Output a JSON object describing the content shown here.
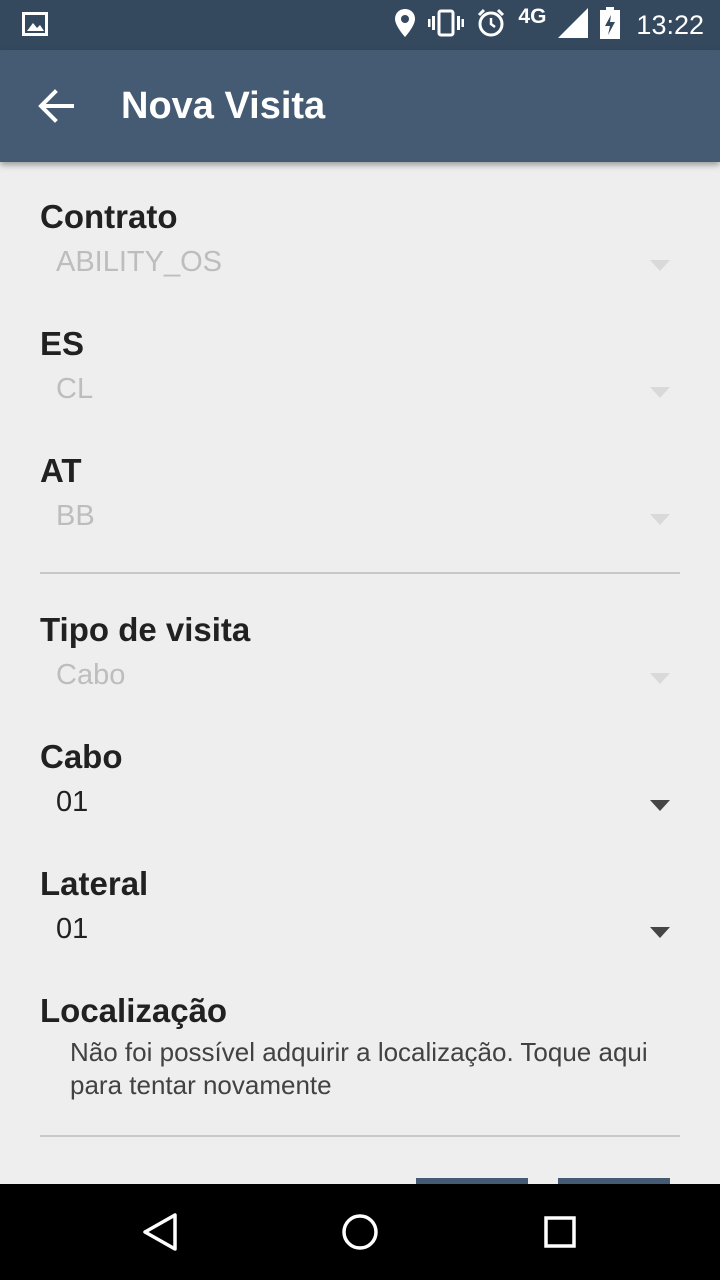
{
  "status_bar": {
    "time": "13:22",
    "network": "4G",
    "icons": [
      "image-notification-icon",
      "location-pin-icon",
      "vibrate-icon",
      "alarm-icon",
      "signal-icon",
      "battery-charging-icon"
    ]
  },
  "app_bar": {
    "title": "Nova Visita",
    "back_icon": "arrow-back-icon"
  },
  "form": {
    "contrato": {
      "label": "Contrato",
      "value": "ABILITY_OS",
      "enabled": false
    },
    "es": {
      "label": "ES",
      "value": "CL",
      "enabled": false
    },
    "at": {
      "label": "AT",
      "value": "BB",
      "enabled": false
    },
    "tipo_visita": {
      "label": "Tipo de visita",
      "value": "Cabo",
      "enabled": false
    },
    "cabo": {
      "label": "Cabo",
      "value": "01",
      "enabled": true
    },
    "lateral": {
      "label": "Lateral",
      "value": "01",
      "enabled": true
    },
    "localizacao": {
      "label": "Localização",
      "message": "Não foi possível adquirir a localização. Toque aqui para tentar novamente"
    }
  },
  "colors": {
    "status_bar": "#34495e",
    "app_bar": "#455a73",
    "background": "#eeeeee",
    "disabled_text": "#bdbdbd"
  },
  "nav_bar": {
    "icons": [
      "back-triangle-icon",
      "home-circle-icon",
      "recents-square-icon"
    ]
  }
}
